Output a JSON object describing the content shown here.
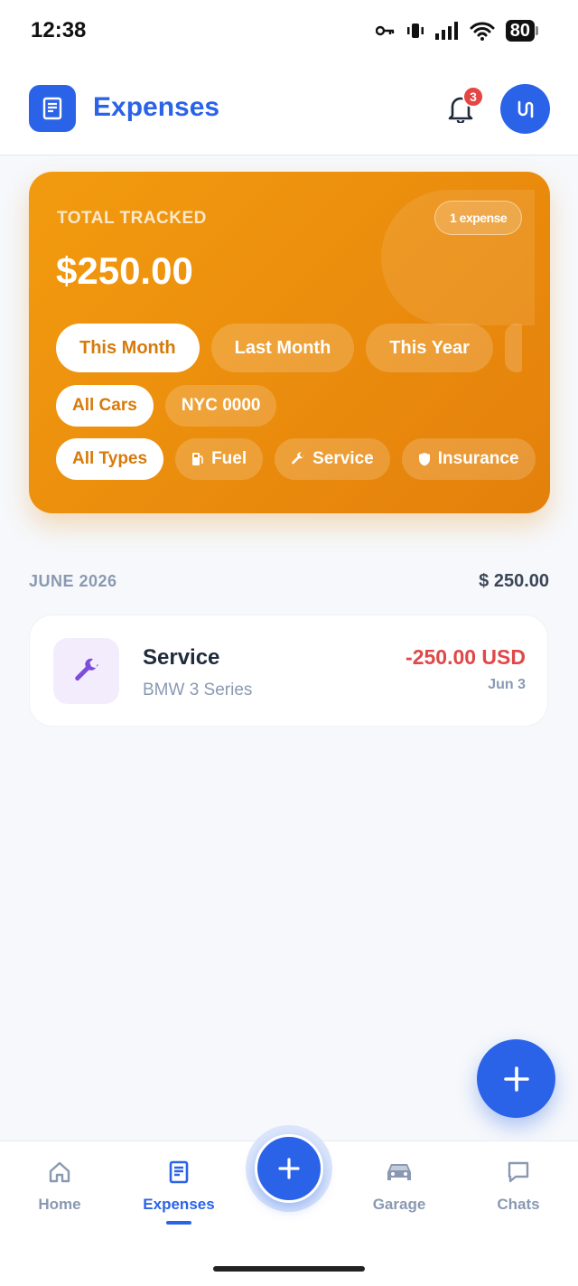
{
  "status_bar": {
    "time": "12:38",
    "battery": "80"
  },
  "header": {
    "title": "Expenses",
    "notification_count": "3"
  },
  "summary": {
    "label": "TOTAL TRACKED",
    "expense_count": "1 expense",
    "total": "$250.00",
    "period_filters": [
      "This Month",
      "Last Month",
      "This Year"
    ],
    "car_filters": [
      "All Cars",
      "NYC 0000"
    ],
    "type_filters": [
      "All Types",
      "Fuel",
      "Service",
      "Insurance"
    ]
  },
  "month_group": {
    "label": "JUNE 2026",
    "total": "$ 250.00"
  },
  "expenses": [
    {
      "title": "Service",
      "vehicle": "BMW 3 Series",
      "amount": "-250.00 USD",
      "date": "Jun 3",
      "icon": "wrench-icon"
    }
  ],
  "nav": {
    "items": [
      {
        "label": "Home",
        "icon": "home-icon"
      },
      {
        "label": "Expenses",
        "icon": "receipt-icon"
      },
      {
        "label": "Garage",
        "icon": "car-icon"
      },
      {
        "label": "Chats",
        "icon": "chat-icon"
      }
    ]
  },
  "colors": {
    "primary": "#2b63e8",
    "card_orange": "#f29b0f",
    "negative": "#e04848"
  }
}
